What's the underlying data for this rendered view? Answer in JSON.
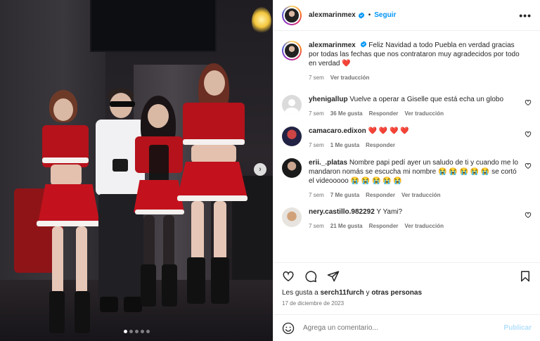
{
  "header": {
    "username": "alexmarinmex",
    "follow_label": "Seguir",
    "separator": "•",
    "more_label": "•••"
  },
  "caption": {
    "username": "alexmarinmex",
    "text": "Feliz Navidad a todo Puebla en verdad gracias por todas las fechas que nos contrataron muy agradecidos por todo en verdad",
    "emoji": "❤️",
    "time": "7 sem",
    "translate_label": "Ver traducción"
  },
  "comments": [
    {
      "username": "yhenigallup",
      "text": "Vuelve a operar a Giselle que está echa un globo",
      "time": "7 sem",
      "likes": "36 Me gusta",
      "reply_label": "Responder",
      "translate_label": "Ver traducción"
    },
    {
      "username": "camacaro.edixon",
      "text": "❤️ ❤️ ❤️ ❤️",
      "time": "7 sem",
      "likes": "1 Me gusta",
      "reply_label": "Responder",
      "translate_label": ""
    },
    {
      "username": "erii._.platas",
      "text": "Nombre papi pedí ayer un saludo de ti y cuando me lo mandaron nomás se escucha mi nombre 😭 😭 😭 😭 😭 se cortó el videooooo 😭 😭 😭 😭 😭",
      "time": "7 sem",
      "likes": "7 Me gusta",
      "reply_label": "Responder",
      "translate_label": "Ver traducción"
    },
    {
      "username": "nery.castillo.982292",
      "text": "Y Yami?",
      "time": "7 sem",
      "likes": "21 Me gusta",
      "reply_label": "Responder",
      "translate_label": "Ver traducción"
    }
  ],
  "likes_line": {
    "prefix": "Les gusta a ",
    "user": "serch11furch",
    "middle": " y ",
    "others": "otras personas"
  },
  "date": "17 de diciembre de 2023",
  "composer": {
    "placeholder": "Agrega un comentario...",
    "publish_label": "Publicar"
  },
  "carousel": {
    "next_label": "›",
    "current_index": 1,
    "total": 5
  },
  "colors": {
    "accent": "#0095f6",
    "heart": "#e0245e",
    "muted": "#737373",
    "publish_disabled": "#b2dffc"
  },
  "icons": [
    "verified-icon",
    "more-icon",
    "heart-icon",
    "comment-icon",
    "share-icon",
    "save-icon",
    "emoji-icon",
    "chevron-right-icon"
  ]
}
